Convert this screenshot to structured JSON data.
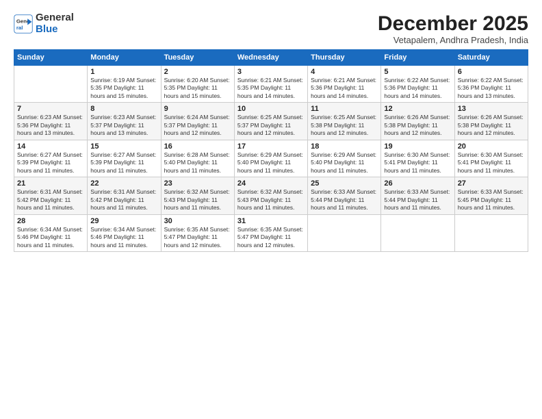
{
  "header": {
    "logo_general": "General",
    "logo_blue": "Blue",
    "month_title": "December 2025",
    "location": "Vetapalem, Andhra Pradesh, India"
  },
  "weekdays": [
    "Sunday",
    "Monday",
    "Tuesday",
    "Wednesday",
    "Thursday",
    "Friday",
    "Saturday"
  ],
  "weeks": [
    [
      {
        "day": "",
        "info": ""
      },
      {
        "day": "1",
        "info": "Sunrise: 6:19 AM\nSunset: 5:35 PM\nDaylight: 11 hours\nand 15 minutes."
      },
      {
        "day": "2",
        "info": "Sunrise: 6:20 AM\nSunset: 5:35 PM\nDaylight: 11 hours\nand 15 minutes."
      },
      {
        "day": "3",
        "info": "Sunrise: 6:21 AM\nSunset: 5:35 PM\nDaylight: 11 hours\nand 14 minutes."
      },
      {
        "day": "4",
        "info": "Sunrise: 6:21 AM\nSunset: 5:36 PM\nDaylight: 11 hours\nand 14 minutes."
      },
      {
        "day": "5",
        "info": "Sunrise: 6:22 AM\nSunset: 5:36 PM\nDaylight: 11 hours\nand 14 minutes."
      },
      {
        "day": "6",
        "info": "Sunrise: 6:22 AM\nSunset: 5:36 PM\nDaylight: 11 hours\nand 13 minutes."
      }
    ],
    [
      {
        "day": "7",
        "info": "Sunrise: 6:23 AM\nSunset: 5:36 PM\nDaylight: 11 hours\nand 13 minutes."
      },
      {
        "day": "8",
        "info": "Sunrise: 6:23 AM\nSunset: 5:37 PM\nDaylight: 11 hours\nand 13 minutes."
      },
      {
        "day": "9",
        "info": "Sunrise: 6:24 AM\nSunset: 5:37 PM\nDaylight: 11 hours\nand 12 minutes."
      },
      {
        "day": "10",
        "info": "Sunrise: 6:25 AM\nSunset: 5:37 PM\nDaylight: 11 hours\nand 12 minutes."
      },
      {
        "day": "11",
        "info": "Sunrise: 6:25 AM\nSunset: 5:38 PM\nDaylight: 11 hours\nand 12 minutes."
      },
      {
        "day": "12",
        "info": "Sunrise: 6:26 AM\nSunset: 5:38 PM\nDaylight: 11 hours\nand 12 minutes."
      },
      {
        "day": "13",
        "info": "Sunrise: 6:26 AM\nSunset: 5:38 PM\nDaylight: 11 hours\nand 12 minutes."
      }
    ],
    [
      {
        "day": "14",
        "info": "Sunrise: 6:27 AM\nSunset: 5:39 PM\nDaylight: 11 hours\nand 11 minutes."
      },
      {
        "day": "15",
        "info": "Sunrise: 6:27 AM\nSunset: 5:39 PM\nDaylight: 11 hours\nand 11 minutes."
      },
      {
        "day": "16",
        "info": "Sunrise: 6:28 AM\nSunset: 5:40 PM\nDaylight: 11 hours\nand 11 minutes."
      },
      {
        "day": "17",
        "info": "Sunrise: 6:29 AM\nSunset: 5:40 PM\nDaylight: 11 hours\nand 11 minutes."
      },
      {
        "day": "18",
        "info": "Sunrise: 6:29 AM\nSunset: 5:40 PM\nDaylight: 11 hours\nand 11 minutes."
      },
      {
        "day": "19",
        "info": "Sunrise: 6:30 AM\nSunset: 5:41 PM\nDaylight: 11 hours\nand 11 minutes."
      },
      {
        "day": "20",
        "info": "Sunrise: 6:30 AM\nSunset: 5:41 PM\nDaylight: 11 hours\nand 11 minutes."
      }
    ],
    [
      {
        "day": "21",
        "info": "Sunrise: 6:31 AM\nSunset: 5:42 PM\nDaylight: 11 hours\nand 11 minutes."
      },
      {
        "day": "22",
        "info": "Sunrise: 6:31 AM\nSunset: 5:42 PM\nDaylight: 11 hours\nand 11 minutes."
      },
      {
        "day": "23",
        "info": "Sunrise: 6:32 AM\nSunset: 5:43 PM\nDaylight: 11 hours\nand 11 minutes."
      },
      {
        "day": "24",
        "info": "Sunrise: 6:32 AM\nSunset: 5:43 PM\nDaylight: 11 hours\nand 11 minutes."
      },
      {
        "day": "25",
        "info": "Sunrise: 6:33 AM\nSunset: 5:44 PM\nDaylight: 11 hours\nand 11 minutes."
      },
      {
        "day": "26",
        "info": "Sunrise: 6:33 AM\nSunset: 5:44 PM\nDaylight: 11 hours\nand 11 minutes."
      },
      {
        "day": "27",
        "info": "Sunrise: 6:33 AM\nSunset: 5:45 PM\nDaylight: 11 hours\nand 11 minutes."
      }
    ],
    [
      {
        "day": "28",
        "info": "Sunrise: 6:34 AM\nSunset: 5:46 PM\nDaylight: 11 hours\nand 11 minutes."
      },
      {
        "day": "29",
        "info": "Sunrise: 6:34 AM\nSunset: 5:46 PM\nDaylight: 11 hours\nand 11 minutes."
      },
      {
        "day": "30",
        "info": "Sunrise: 6:35 AM\nSunset: 5:47 PM\nDaylight: 11 hours\nand 12 minutes."
      },
      {
        "day": "31",
        "info": "Sunrise: 6:35 AM\nSunset: 5:47 PM\nDaylight: 11 hours\nand 12 minutes."
      },
      {
        "day": "",
        "info": ""
      },
      {
        "day": "",
        "info": ""
      },
      {
        "day": "",
        "info": ""
      }
    ]
  ]
}
